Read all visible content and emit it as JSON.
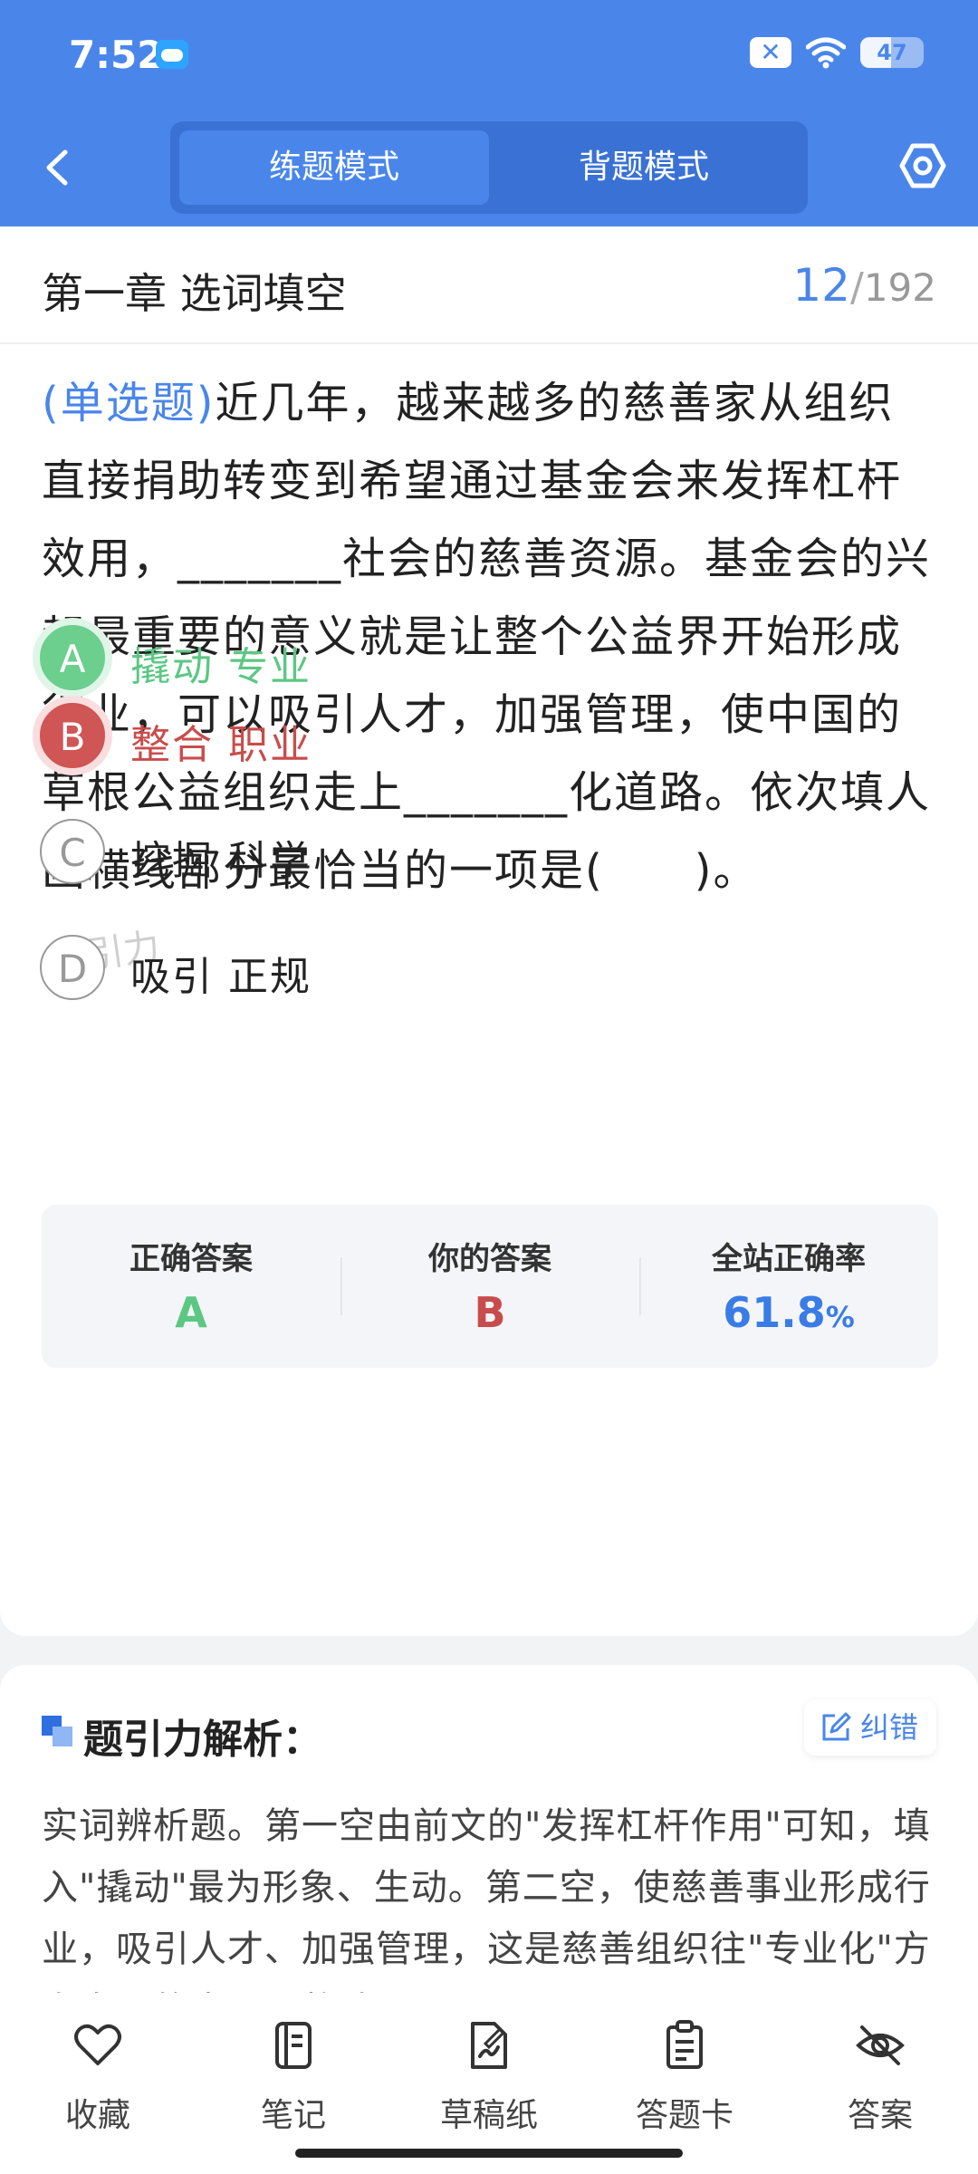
{
  "status": {
    "time": "7:52",
    "battery": "47"
  },
  "header": {
    "tabs": [
      {
        "label": "练题模式",
        "active": true
      },
      {
        "label": "背题模式",
        "active": false
      }
    ]
  },
  "chapter": {
    "title": "第一章 选词填空",
    "current": "12",
    "separator": "/",
    "total": "192"
  },
  "question": {
    "tag": "(单选题)",
    "text": "近几年，越来越多的慈善家从组织直接捐助转变到希望通过基金会来发挥杠杆效用，_______社会的慈善资源。基金会的兴起最重要的意义就是让整个公益界开始形成行业，可以吸引人才，加强管理，使中国的草根公益组织走上_______化道路。依次填人画横线部分最恰当的一项是(　　)。"
  },
  "options": [
    {
      "letter": "A",
      "text": "撬动 专业",
      "state": "correct"
    },
    {
      "letter": "B",
      "text": "整合 职业",
      "state": "wrong"
    },
    {
      "letter": "C",
      "text": "挖掘 科学",
      "state": "none"
    },
    {
      "letter": "D",
      "text": "吸引 正规",
      "state": "none"
    }
  ],
  "watermark": "题引力",
  "result": {
    "correct_label": "正确答案",
    "correct_value": "A",
    "yours_label": "你的答案",
    "yours_value": "B",
    "rate_label": "全站正确率",
    "rate_value": "61.8",
    "rate_unit": "%"
  },
  "analysis": {
    "title": "题引力解析：",
    "fix_label": "纠错",
    "text": "实词辨析题。第一空由前文的\"发挥杠杆作用\"可知，填入\"撬动\"最为形象、生动。第二空，使慈善事业形成行业，吸引人才、加强管理，这是慈善组织往\"专业化\"方向发展的表现，故选A。"
  },
  "nav": [
    {
      "label": "收藏",
      "icon": "heart-icon"
    },
    {
      "label": "笔记",
      "icon": "notebook-icon"
    },
    {
      "label": "草稿纸",
      "icon": "draft-icon"
    },
    {
      "label": "答题卡",
      "icon": "clipboard-icon"
    },
    {
      "label": "答案",
      "icon": "eye-off-icon"
    }
  ],
  "colors": {
    "primary": "#4a86ea",
    "correct": "#5cc783",
    "wrong": "#c94c4c"
  }
}
